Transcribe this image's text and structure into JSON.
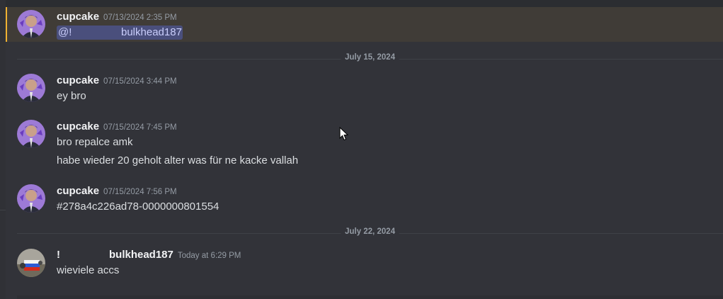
{
  "messages": [
    {
      "username": "cupcake",
      "timestamp": "07/13/2024 2:35 PM",
      "mention_prefix": "@!",
      "mention_name": "bulkhead187"
    },
    {
      "username": "cupcake",
      "timestamp": "07/15/2024 3:44 PM",
      "lines": [
        "ey bro"
      ]
    },
    {
      "username": "cupcake",
      "timestamp": "07/15/2024 7:45 PM",
      "lines": [
        "bro repalce amk",
        "habe wieder 20 geholt alter was für ne kacke vallah"
      ]
    },
    {
      "username": "cupcake",
      "timestamp": "07/15/2024 7:56 PM",
      "lines": [
        "#278a4c226ad78-0000000801554"
      ]
    },
    {
      "username_prefix": "!",
      "username": "bulkhead187",
      "timestamp": "Today at 6:29 PM",
      "lines": [
        "wieviele accs"
      ]
    }
  ],
  "dividers": [
    "July 15, 2024",
    "July 22, 2024"
  ],
  "colors": {
    "background": "#323339",
    "highlight": "#403c37",
    "highlight_bar": "#f0b232",
    "mention_bg": "#4a4f7c",
    "mention_text": "#c9cdfb",
    "username": "#f2f3f5",
    "timestamp": "#949ba4",
    "text": "#dbdee1"
  }
}
